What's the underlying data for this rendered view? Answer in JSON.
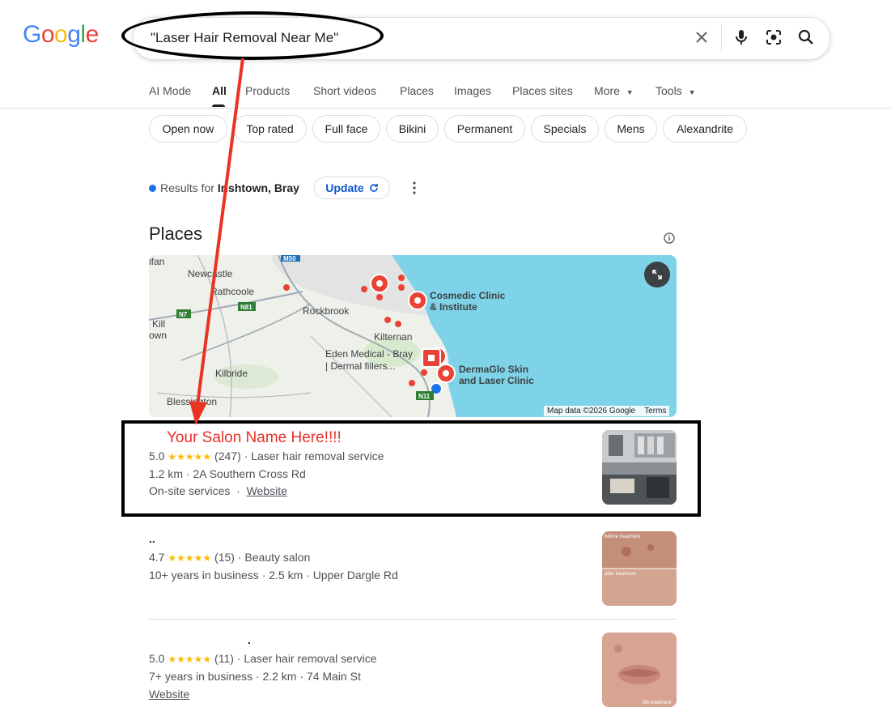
{
  "logo": [
    "G",
    "o",
    "o",
    "g",
    "l",
    "e"
  ],
  "search": {
    "query": "\"Laser Hair Removal Near Me\""
  },
  "nav": [
    {
      "label": "AI Mode"
    },
    {
      "label": "All"
    },
    {
      "label": "Products"
    },
    {
      "label": "Short videos"
    },
    {
      "label": "Places"
    },
    {
      "label": "Images"
    },
    {
      "label": "Places sites"
    },
    {
      "label": "More"
    },
    {
      "label": "Tools"
    }
  ],
  "chips": [
    "Open now",
    "Top rated",
    "Full face",
    "Bikini",
    "Permanent",
    "Specials",
    "Mens",
    "Alexandrite"
  ],
  "location": {
    "prefix": "Results for ",
    "place": "Irishtown, Bray",
    "update": "Update"
  },
  "places": {
    "title": "Places"
  },
  "map": {
    "labels": [
      "ifan",
      "Newcastle",
      "Rathcoole",
      "Rockbrook",
      "Kill",
      "own",
      "Kilternan",
      "Eden Medical - Bray",
      "| Dermal fillers...",
      "Kilbride",
      "Blessington",
      "Cosmedic Clinic",
      "& Institute",
      "DermaGlo Skin",
      "and Laser Clinic"
    ],
    "road_badges": [
      "M50",
      "N7",
      "N81",
      "N11"
    ],
    "attribution": "Map data ©2026 Google",
    "terms": "Terms",
    "colors": {
      "sea": "#7fd3e8",
      "land": "#eef0ea",
      "pin": "#ea4335"
    }
  },
  "results": [
    {
      "name": "Your Salon Name Here!!!!",
      "rating": "5.0",
      "stars": "★★★★★",
      "reviews": "(247)",
      "category": "Laser hair removal service",
      "line2": "1.2 km · 2A Southern Cross Rd",
      "line3_a": "On-site services",
      "line3_sep": "·",
      "line3_link": "Website"
    },
    {
      "name": "..",
      "rating": "4.7",
      "stars": "★★★★★",
      "reviews": "(15)",
      "category": "Beauty salon",
      "line2": "10+ years in business · 2.5 km · Upper Dargle Rd",
      "thumb_top": "before treatment",
      "thumb_bottom": "after treatment"
    },
    {
      "name": ".",
      "rating": "5.0",
      "stars": "★★★★★",
      "reviews": "(11)",
      "category": "Laser hair removal service",
      "line2": "7+ years in business · 2.2 km · 74 Main St",
      "line3_link": "Website",
      "thumb_caption": "5th treatment"
    }
  ]
}
